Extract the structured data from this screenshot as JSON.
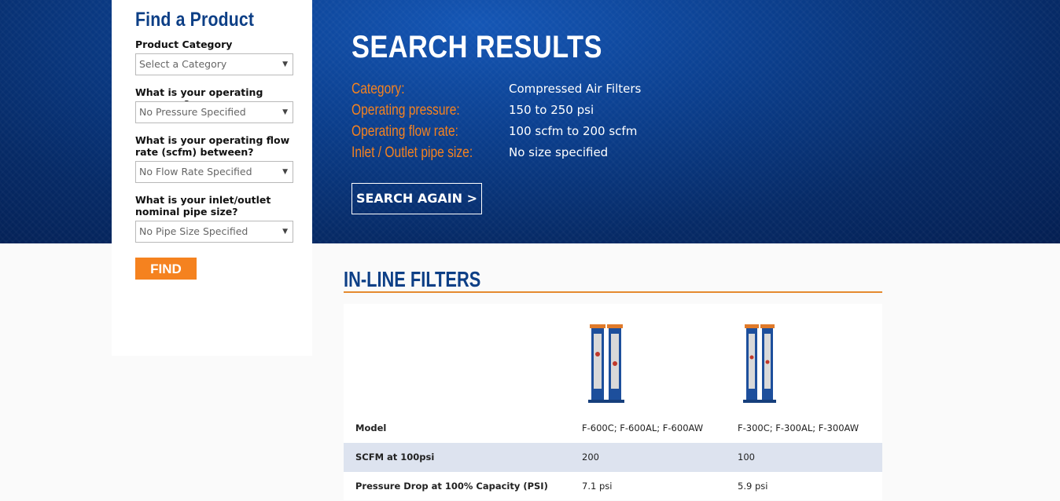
{
  "sidebar": {
    "title": "Find a Product",
    "fields": [
      {
        "label": "Product Category",
        "value": "Select a Category"
      },
      {
        "label": "What is your operating pressure?",
        "value": "No Pressure Specified"
      },
      {
        "label": "What is your operating flow rate (scfm) between?",
        "value": "No Flow Rate Specified"
      },
      {
        "label": "What is your inlet/outlet nominal pipe size?",
        "value": "No Pipe Size Specified"
      }
    ],
    "find_label": "FIND"
  },
  "results": {
    "title": "SEARCH RESULTS",
    "criteria": [
      {
        "label": "Category:",
        "value": "Compressed Air Filters"
      },
      {
        "label": "Operating pressure:",
        "value": "150 to 250 psi"
      },
      {
        "label": "Operating flow rate:",
        "value": "100 scfm to 200 scfm"
      },
      {
        "label": "Inlet / Outlet pipe size:",
        "value": "No size specified"
      }
    ],
    "search_again_label": "SEARCH AGAIN >"
  },
  "section": {
    "title": "IN-LINE FILTERS",
    "rows": [
      {
        "label": "Model",
        "values": [
          "F-600C; F-600AL; F-600AW",
          "F-300C; F-300AL; F-300AW"
        ]
      },
      {
        "label": "SCFM at 100psi",
        "values": [
          "200",
          "100"
        ]
      },
      {
        "label": "Pressure Drop at 100% Capacity (PSI)",
        "values": [
          "7.1 psi",
          "5.9 psi"
        ]
      }
    ]
  },
  "colors": {
    "accent_orange": "#f5821f",
    "brand_blue": "#0d3f86",
    "hero_blue": "#0b3f8e",
    "row_shade": "#dde3ef"
  }
}
